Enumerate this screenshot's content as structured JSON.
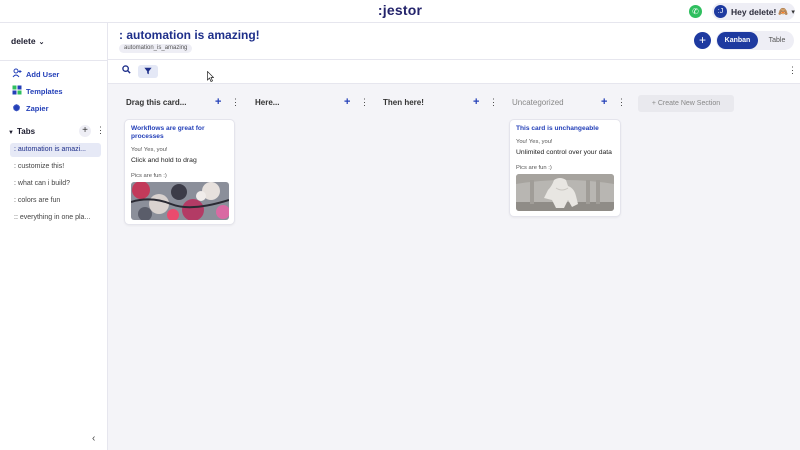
{
  "topbar": {
    "logo": ":jestor",
    "user_name": "Hey delete!",
    "user_initial": ":J",
    "user_emoji": "🙈"
  },
  "sidebar": {
    "workspace": "delete",
    "links": [
      {
        "label": "Add User"
      },
      {
        "label": "Templates"
      },
      {
        "label": "Zapier"
      }
    ],
    "tabs_header": "Tabs",
    "tabs": [
      ": automation is amazi...",
      ": customize this!",
      ": what can i build?",
      ": colors are fun",
      ":: everything in one pla..."
    ]
  },
  "page": {
    "title": ": automation is amazing!",
    "badge": "automation_is_amazing",
    "views": {
      "kanban": "Kanban",
      "table": "Table"
    }
  },
  "board": {
    "columns": [
      {
        "name": "Drag this card..."
      },
      {
        "name": "Here..."
      },
      {
        "name": "Then here!"
      },
      {
        "name": "Uncategorized"
      }
    ],
    "create_section": "+ Create New Section",
    "cards": [
      {
        "title": "Workflows are great for processes",
        "small1": "You! Yes, you!",
        "text": "Click and hold to drag",
        "small2": "Pics are fun :)"
      },
      {
        "title": "This card is unchangeable",
        "small1": "You! Yes, you!",
        "text": "Unlimited control over your data",
        "small2": "Pics are fun :)"
      }
    ]
  },
  "colors": {
    "brand": "#1e3aa0",
    "accent_text": "#2440b8",
    "background": "#f4f4f8"
  }
}
